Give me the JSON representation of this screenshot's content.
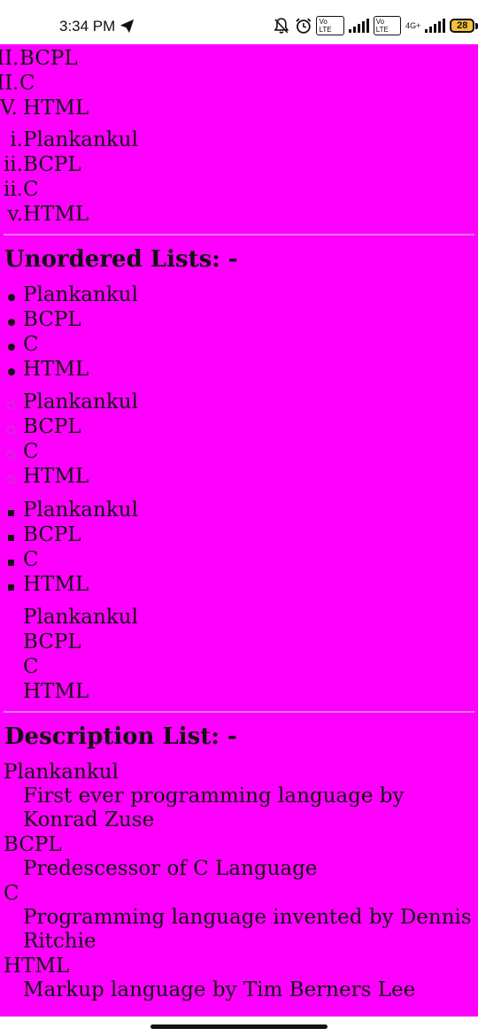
{
  "status_bar": {
    "time": "3:34 PM",
    "battery": "28",
    "net_label": "4G+",
    "volte_1": "Vo LTE",
    "volte_2": "Vo LTE"
  },
  "ordered_upper_roman": {
    "items": [
      {
        "marker": "II.",
        "text": "BCPL"
      },
      {
        "marker": "II.",
        "text": "C"
      },
      {
        "marker": "V.",
        "text": "HTML"
      }
    ]
  },
  "ordered_lower_roman": {
    "items": [
      {
        "marker": "i.",
        "text": "Plankankul"
      },
      {
        "marker": "ii.",
        "text": "BCPL"
      },
      {
        "marker": "ii.",
        "text": "C"
      },
      {
        "marker": "v.",
        "text": "HTML"
      }
    ]
  },
  "unordered": {
    "heading": "Unordered Lists: -",
    "disc": [
      "Plankankul",
      "BCPL",
      "C",
      "HTML"
    ],
    "circle": [
      "Plankankul",
      "BCPL",
      "C",
      "HTML"
    ],
    "square": [
      "Plankankul",
      "BCPL",
      "C",
      "HTML"
    ],
    "none": [
      "Plankankul",
      "BCPL",
      "C",
      "HTML"
    ]
  },
  "description": {
    "heading": "Description List: -",
    "items": [
      {
        "term": "Plankankul",
        "desc": "First ever programming language by Konrad Zuse"
      },
      {
        "term": "BCPL",
        "desc": "Predescessor of C Language"
      },
      {
        "term": "C",
        "desc": "Programming language invented by Dennis Ritchie"
      },
      {
        "term": "HTML",
        "desc": "Markup language by Tim Berners Lee"
      }
    ]
  },
  "colors": {
    "page_background": "#ff00ff",
    "text": "#111111"
  }
}
